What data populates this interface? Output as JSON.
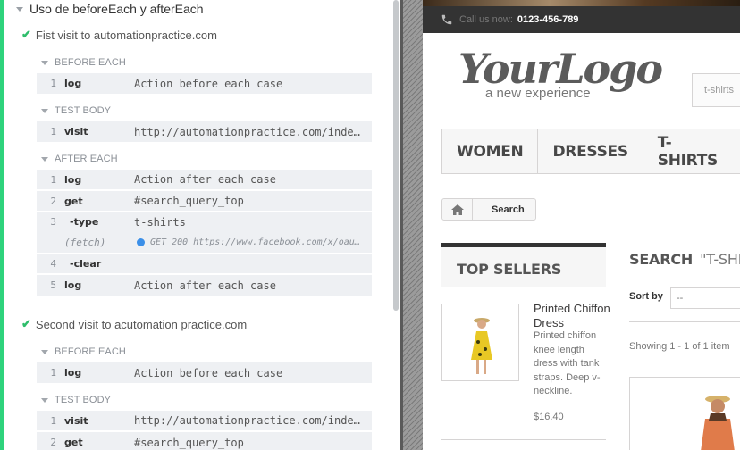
{
  "runner": {
    "suite_title": "Uso de beforeEach y afterEach",
    "tests": [
      {
        "title": "Fist visit to automationpractice.com",
        "before_each": {
          "label": "BEFORE EACH",
          "commands": [
            {
              "num": "1",
              "name": "log",
              "message": "Action before each case"
            }
          ]
        },
        "test_body": {
          "label": "TEST BODY",
          "commands": [
            {
              "num": "1",
              "name": "visit",
              "message": "http://automationpractice.com/index…"
            }
          ]
        },
        "after_each": {
          "label": "AFTER EACH",
          "commands": [
            {
              "num": "1",
              "name": "log",
              "message": "Action after each case"
            },
            {
              "num": "2",
              "name": "get",
              "message": "#search_query_top"
            },
            {
              "num": "3",
              "name": "-type",
              "message": "t-shirts"
            },
            {
              "num": "",
              "name": "(fetch)",
              "message": "GET 200 https://www.facebook.com/x/oau…"
            },
            {
              "num": "4",
              "name": "-clear",
              "message": ""
            },
            {
              "num": "5",
              "name": "log",
              "message": "Action after each case"
            }
          ]
        }
      },
      {
        "title": "Second visit to acutomation practice.com",
        "before_each": {
          "label": "BEFORE EACH",
          "commands": [
            {
              "num": "1",
              "name": "log",
              "message": "Action before each case"
            }
          ]
        },
        "test_body": {
          "label": "TEST BODY",
          "commands": [
            {
              "num": "1",
              "name": "visit",
              "message": "http://automationpractice.com/index…"
            },
            {
              "num": "2",
              "name": "get",
              "message": "#search_query_top"
            }
          ]
        }
      }
    ]
  },
  "app": {
    "call_label": "Call us now:",
    "call_number": "0123-456-789",
    "logo_main": "YourLogo",
    "logo_sub": "a new experience",
    "search_placeholder": "t-shirts",
    "menu": [
      "WOMEN",
      "DRESSES",
      "T-SHIRTS"
    ],
    "breadcrumb": "Search",
    "top_sellers_title": "TOP SELLERS",
    "product": {
      "name": "Printed Chiffon Dress",
      "description": "Printed chiffon knee length dress with tank straps. Deep v-neckline.",
      "price": "$16.40"
    },
    "search_heading": "SEARCH",
    "search_query": "\"T-SHIRTS\"",
    "sort_label": "Sort by",
    "sort_value": "--",
    "showing": "Showing 1 - 1 of 1 item"
  },
  "colors": {
    "pass_green": "#2ed37c",
    "fetch_dot": "#3b8fe8",
    "call_bar": "#333333"
  }
}
